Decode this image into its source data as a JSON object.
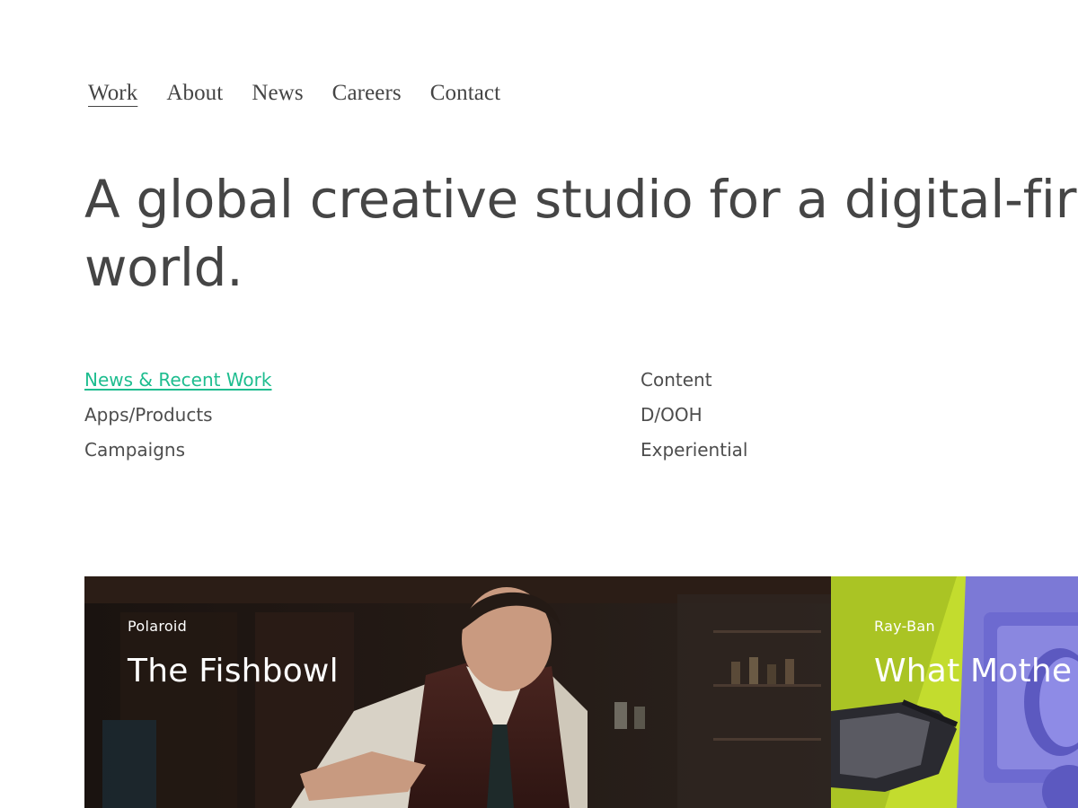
{
  "nav": {
    "items": [
      {
        "label": "Work"
      },
      {
        "label": "About"
      },
      {
        "label": "News"
      },
      {
        "label": "Careers"
      },
      {
        "label": "Contact"
      }
    ],
    "active": "Work"
  },
  "hero": {
    "headline": "A global creative studio for a digital-first world."
  },
  "filters": {
    "left": [
      "News & Recent Work",
      "Apps/Products",
      "Campaigns"
    ],
    "right": [
      "Content",
      "D/OOH",
      "Experiential"
    ],
    "active": "News & Recent Work",
    "accent_color": "#1ebd8f"
  },
  "tiles": [
    {
      "client": "Polaroid",
      "title": "The Fishbowl"
    },
    {
      "client": "Ray-Ban",
      "title": "What Mothe"
    }
  ]
}
